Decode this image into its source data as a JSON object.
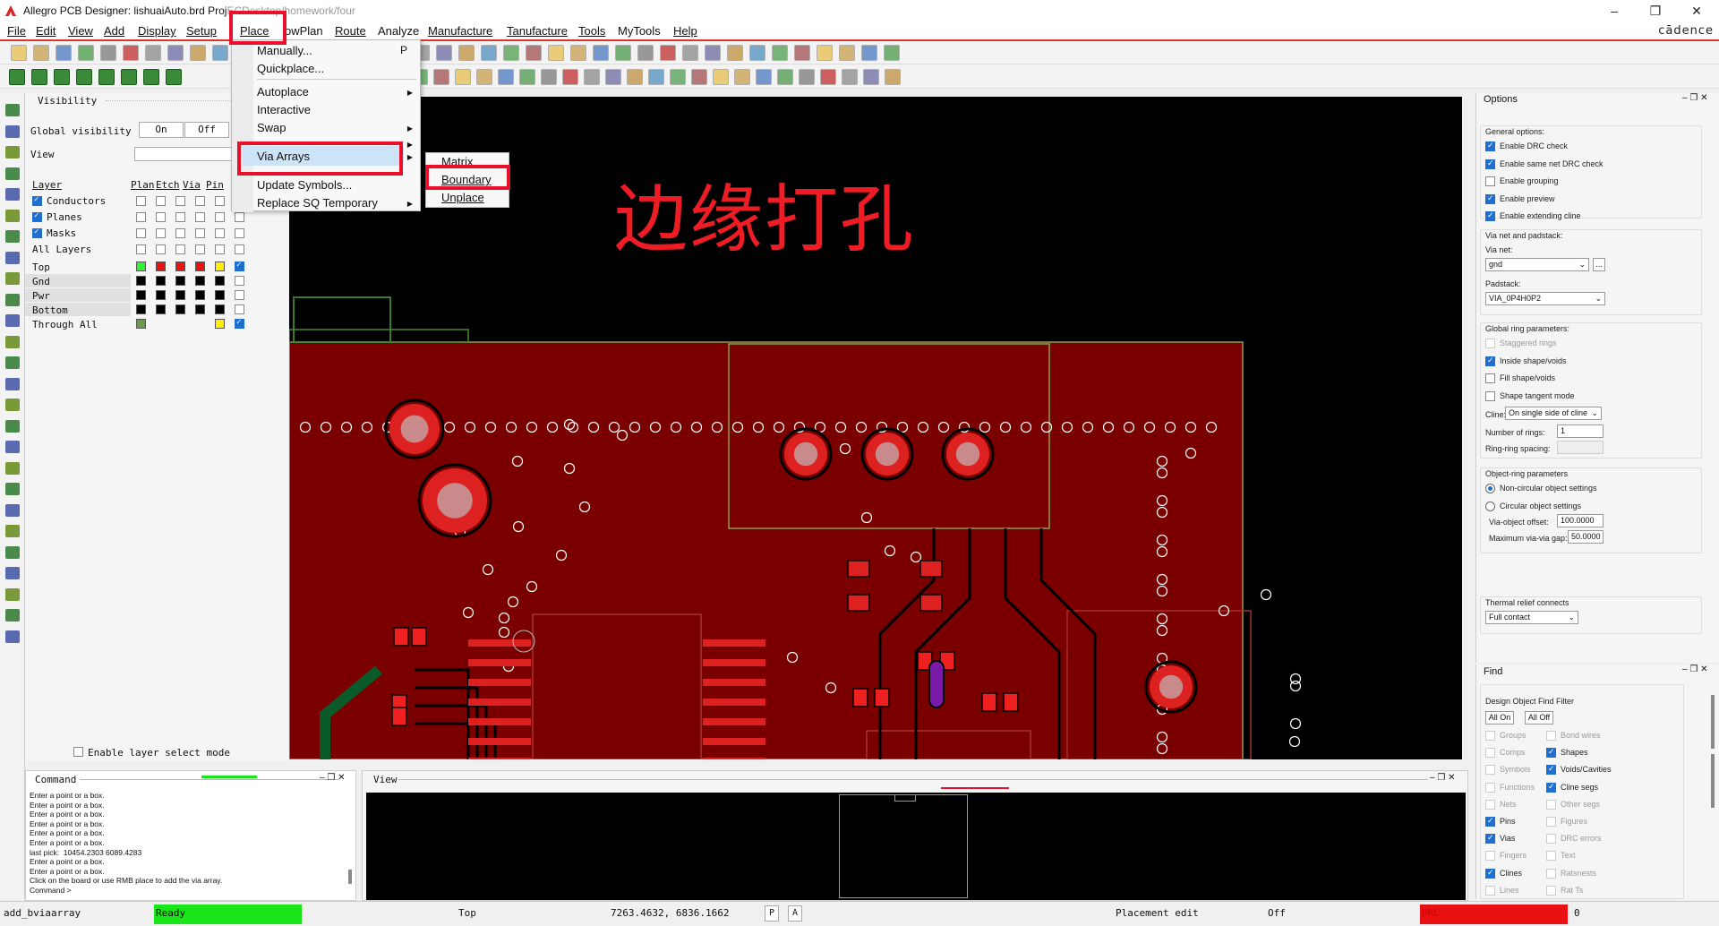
{
  "titlebar": {
    "app": "Allegro PCB Designer: lishuaiAuto.brd",
    "project": "Proj",
    "path": "ECDesktop/homework/four"
  },
  "window_buttons": {
    "minimize": "–",
    "restore": "❐",
    "close": "✕"
  },
  "brand": "cādence",
  "menu": [
    "File",
    "Edit",
    "View",
    "Add",
    "Display",
    "Setup",
    "Place",
    "FlowPlan",
    "Route",
    "Analyze",
    "Manufacture",
    "Tanufacture",
    "Tools",
    "MyTools",
    "Help"
  ],
  "menu_visible": {
    "flowplan": "owPlan",
    "tanufacture": "Tanufacture"
  },
  "place_menu": {
    "items": [
      {
        "label": "Manually...",
        "shortcut": "P"
      },
      {
        "label": "Quickplace..."
      },
      {
        "label": "Autoplace",
        "submenu": true
      },
      {
        "label": "Interactive"
      },
      {
        "label": "Swap",
        "submenu": true
      },
      {
        "label": "Via Arrays",
        "submenu": true,
        "selected": true
      },
      {
        "label": "Update Symbols..."
      },
      {
        "label": "Replace SQ Temporary",
        "submenu": true
      }
    ]
  },
  "via_submenu": [
    "Matrix",
    "Boundary",
    "Unplace"
  ],
  "annotation_text": "边缘打孔",
  "visibility": {
    "title": "Visibility",
    "global_label": "Global visibility",
    "on": "On",
    "off": "Off",
    "view_label": "View",
    "headers": [
      "Layer",
      "Plan",
      "Etch",
      "Via",
      "Pin"
    ],
    "groups": [
      "Conductors",
      "Planes",
      "Masks",
      "All Layers"
    ],
    "layers": [
      "Top",
      "Gnd",
      "Pwr",
      "Bottom",
      "Through All"
    ],
    "enable_layer_select": "Enable layer select mode"
  },
  "options": {
    "title": "Options",
    "general": "General options:",
    "general_items": [
      {
        "label": "Enable DRC check",
        "on": true
      },
      {
        "label": "Enable same net DRC check",
        "on": true
      },
      {
        "label": "Enable grouping",
        "on": false
      },
      {
        "label": "Enable preview",
        "on": true
      },
      {
        "label": "Enable extending cline",
        "on": true
      }
    ],
    "via_net_title": "Via net and padstack:",
    "via_net_label": "Via net:",
    "via_net": "gnd",
    "dots": "...",
    "padstack_label": "Padstack:",
    "padstack": "VIA_0P4H0P2",
    "ring_title": "Global ring parameters:",
    "ring_items": [
      {
        "label": "Staggered rings",
        "on": false,
        "dim": true
      },
      {
        "label": "Inside shape/voids",
        "on": true
      },
      {
        "label": "Fill shape/voids",
        "on": false
      },
      {
        "label": "Shape tangent mode",
        "on": false
      }
    ],
    "cline_label": "Cline:",
    "cline": "On single side of cline",
    "rings_label": "Number of rings:",
    "rings": "1",
    "ringspacing_label": "Ring-ring spacing:",
    "obj_title": "Object-ring parameters",
    "obj_items": [
      {
        "label": "Non-circular object settings",
        "on": true
      },
      {
        "label": "Circular object settings",
        "on": false
      }
    ],
    "offset_label": "Via-object offset:",
    "offset": "100.0000",
    "gap_label": "Maximum via-via gap:",
    "gap": "50.0000",
    "thermal_label": "Thermal relief connects",
    "thermal": "Full contact"
  },
  "find": {
    "title": "Find",
    "filter": "Design Object Find Filter",
    "all_on": "All On",
    "all_off": "All Off",
    "left": [
      {
        "label": "Groups",
        "on": false
      },
      {
        "label": "Comps",
        "on": false
      },
      {
        "label": "Symbols",
        "on": false
      },
      {
        "label": "Functions",
        "on": false
      },
      {
        "label": "Nets",
        "on": false
      },
      {
        "label": "Pins",
        "on": true
      },
      {
        "label": "Vias",
        "on": true
      },
      {
        "label": "Fingers",
        "on": false
      },
      {
        "label": "Clines",
        "on": true
      },
      {
        "label": "Lines",
        "on": false
      }
    ],
    "right": [
      {
        "label": "Bond wires",
        "on": false
      },
      {
        "label": "Shapes",
        "on": true
      },
      {
        "label": "Voids/Cavities",
        "on": true
      },
      {
        "label": "Cline segs",
        "on": true
      },
      {
        "label": "Other segs",
        "on": false
      },
      {
        "label": "Figures",
        "on": false
      },
      {
        "label": "DRC errors",
        "on": false
      },
      {
        "label": "Text",
        "on": false
      },
      {
        "label": "Ratsnests",
        "on": false
      },
      {
        "label": "Rat Ts",
        "on": false
      }
    ]
  },
  "command": {
    "title": "Command",
    "log": [
      "Enter a point or a box.",
      "Enter a point or a box.",
      "Enter a point or a box.",
      "Enter a point or a box.",
      "Enter a point or a box.",
      "Enter a point or a box.",
      "last pick:  10454.2303 6089.4283",
      "Enter a point or a box.",
      "Enter a point or a box.",
      "Click on the board or use RMB place to add the via array.",
      "Command >"
    ]
  },
  "viewpanel": {
    "title": "View"
  },
  "status": {
    "command": "add_bviaarray",
    "state": "Ready",
    "layer": "Top",
    "coords": "7263.4632, 6836.1662",
    "p": "P",
    "a": "A",
    "mode": "Placement edit",
    "off": "Off",
    "drc": "DRC",
    "count": "0"
  },
  "colors": {
    "board": "#7a0000",
    "accent": "#e8102a",
    "ready": "#19e619",
    "drc": "#e81010",
    "canvas": "#000000"
  }
}
